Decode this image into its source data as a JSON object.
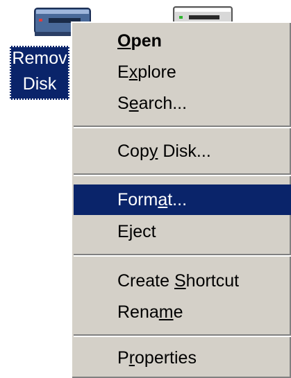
{
  "desktop": {
    "icon_label": "Remov\nDisk"
  },
  "context_menu": {
    "items": [
      {
        "pre": "",
        "ul": "O",
        "post": "pen"
      },
      {
        "pre": "E",
        "ul": "x",
        "post": "plore"
      },
      {
        "pre": "S",
        "ul": "e",
        "post": "arch..."
      },
      {
        "pre": "Cop",
        "ul": "y",
        "post": " Disk..."
      },
      {
        "pre": "Form",
        "ul": "a",
        "post": "t..."
      },
      {
        "pre": "E",
        "ul": "j",
        "post": "ect"
      },
      {
        "pre": "Create ",
        "ul": "S",
        "post": "hortcut"
      },
      {
        "pre": "Rena",
        "ul": "m",
        "post": "e"
      },
      {
        "pre": "P",
        "ul": "r",
        "post": "operties"
      }
    ],
    "selected_item": "Format..."
  },
  "colors": {
    "menu_bg": "#d4d0c8",
    "selection": "#0a246a",
    "selection_text": "#ffffff"
  }
}
